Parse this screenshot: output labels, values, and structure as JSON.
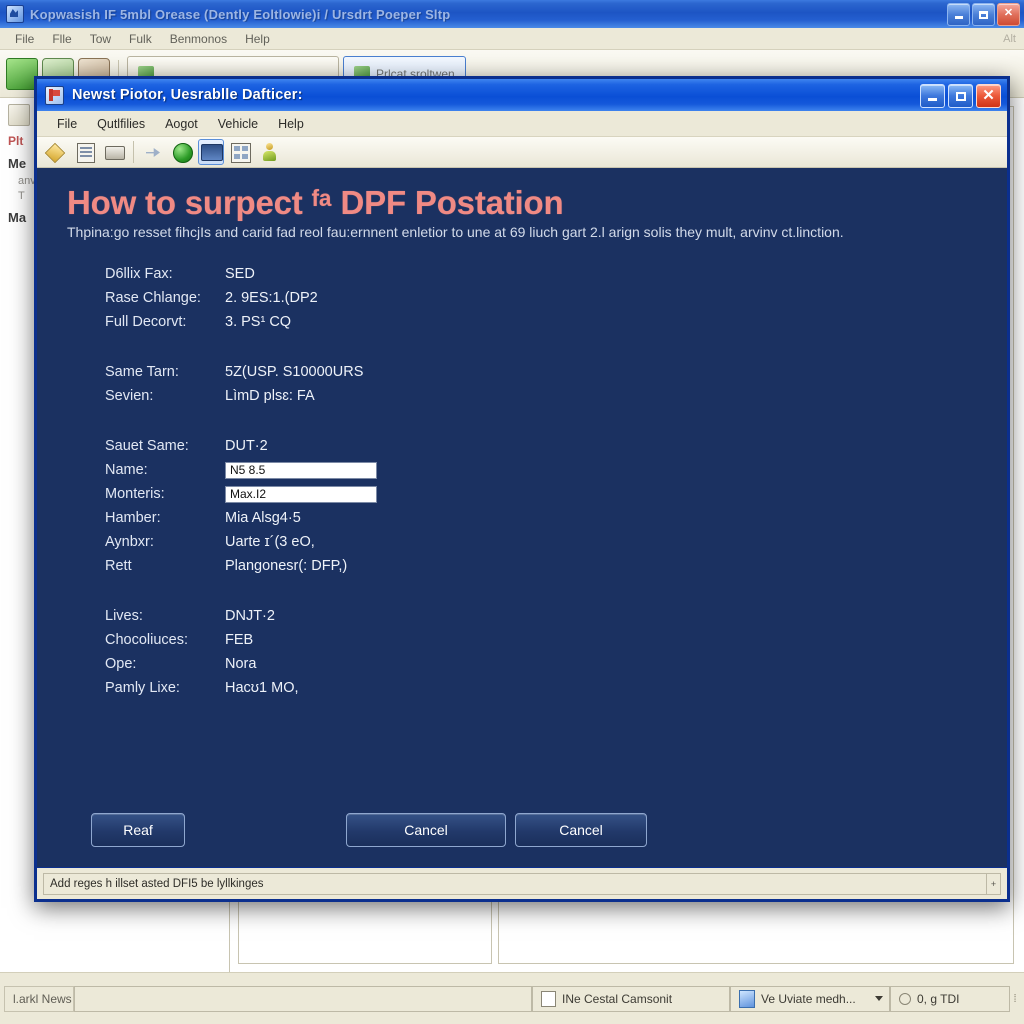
{
  "background_window": {
    "title": "Kopwasish IF 5mbl Orease (Dently Eoltlowie)i / Ursdrt Poeper Sltp",
    "title_icon": "app-icon",
    "window_buttons": [
      "minimize",
      "maximize",
      "close"
    ],
    "menu": [
      "File",
      "Flle",
      "Tow",
      "Fulk",
      "Benmonos",
      "Help"
    ],
    "menu_right_hint": "Alt",
    "toolbar": {
      "icons": [
        "export-icon",
        "canister-icon",
        "vehicle-icon"
      ],
      "buttons": [
        {
          "label": "",
          "icon": "blank-icon"
        },
        {
          "label": "Prlcat sroltwen",
          "icon": "green-car-icon"
        }
      ]
    },
    "sidebar": {
      "icons": [
        "doc-icon",
        "list-icon"
      ],
      "heading_red": "Plt",
      "heading_1": "Me",
      "line_1": "anv",
      "line_2": "T",
      "heading_2": "Ma"
    },
    "statusbar": {
      "left_label": "l.arkl News",
      "middle_label": "",
      "checkbox_label": "INe Cestal Camsonit",
      "dropdown_label": "Ve Uviate medh...",
      "right_label": "0, g TDI",
      "grip": "⁞"
    }
  },
  "dialog": {
    "title": "Newst Piotor, Uesrablle Dafticer:",
    "title_icon": "flag-icon",
    "window_buttons": [
      "minimize",
      "maximize",
      "close"
    ],
    "menu": [
      "File",
      "Qutlfilies",
      "Aogot",
      "Vehicle",
      "Help"
    ],
    "toolbar_icons": [
      "tag-icon",
      "report-icon",
      "print-icon",
      "transfer-icon",
      "globe-icon",
      "monitor-icon",
      "layout-icon",
      "person-icon"
    ],
    "heading": "How to surpect ᶠᵃ DPF Postation",
    "subtitle": "Thpina:go resset ﬁhcjIs and carid fad reol fau:ernnent enletior to une at 69 liuch gart 2.l arign solis they mult, arvinv ct.linction.",
    "groups": [
      {
        "name": "group-1",
        "rows": [
          {
            "key": "D6llix Fax:",
            "value": "SED",
            "type": "text"
          },
          {
            "key": "Rase Chlange:",
            "value": "2. 9ES:1.(DP2",
            "type": "text"
          },
          {
            "key": "Full Decorvt:",
            "value": "3. PS¹ CQ",
            "type": "text"
          }
        ]
      },
      {
        "name": "group-2",
        "rows": [
          {
            "key": "Same Tarn:",
            "value": "5Z(USP. S10000URS",
            "type": "text"
          },
          {
            "key": "Sevien:",
            "value": "LìmD plsɛ: FA",
            "type": "text"
          }
        ]
      },
      {
        "name": "group-3",
        "rows": [
          {
            "key": "Sauet Same:",
            "value": "DUT·2",
            "type": "text"
          },
          {
            "key": "Name:",
            "value": "N5 8.5",
            "type": "input"
          },
          {
            "key": "Monteris:",
            "value": "Max.I2",
            "type": "input"
          },
          {
            "key": "Hamber:",
            "value": "Mia Alsg4·5",
            "type": "text"
          },
          {
            "key": "Aynbxr:",
            "value": "Uarte ɪ´(3 eO,",
            "type": "text"
          },
          {
            "key": "Rett",
            "value": "Plangonesr(: DFP,)",
            "type": "text"
          }
        ]
      },
      {
        "name": "group-4",
        "rows": [
          {
            "key": "Lives:",
            "value": "DNJT·2",
            "type": "text"
          },
          {
            "key": "Chocoliuces:",
            "value": "FEB",
            "type": "text"
          },
          {
            "key": "Ope:",
            "value": "Nora",
            "type": "text"
          },
          {
            "key": "Pamly Lixe:",
            "value": "Hacʊ1 MO,",
            "type": "text"
          }
        ]
      }
    ],
    "buttons": [
      {
        "name": "read-button",
        "label": "Reaf"
      },
      {
        "name": "cancel-button-1",
        "label": "Cancel"
      },
      {
        "name": "cancel-button-2",
        "label": "Cancel"
      }
    ],
    "status_text": "Add reges h illset asted DFI5 be lyllkinges",
    "status_spinner": "+"
  },
  "colors": {
    "dialog_background": "#1b3161",
    "dialog_border": "#0b2f8e",
    "heading": "#f08a84",
    "titlebar_blue": "#0a4fd6",
    "chrome_beige": "#ece9d8",
    "button_face": "#22396a"
  }
}
